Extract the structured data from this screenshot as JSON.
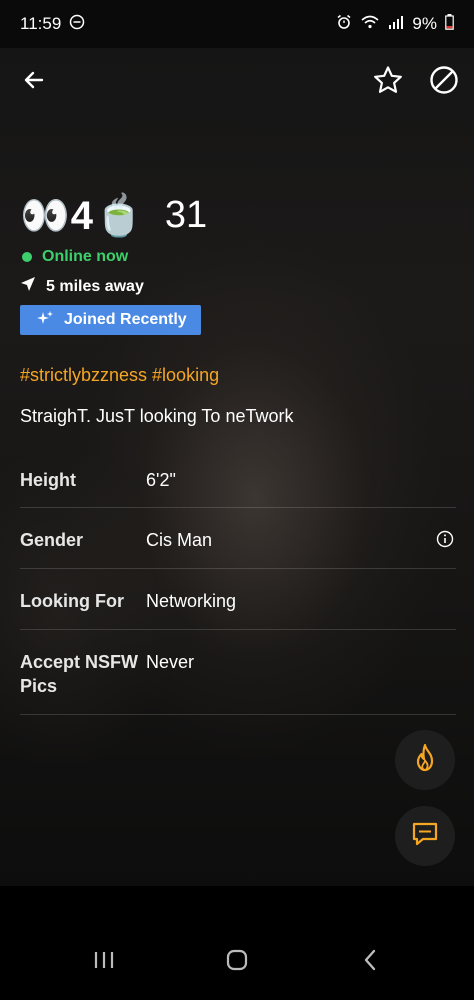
{
  "status_bar": {
    "time": "11:59",
    "battery": "9%"
  },
  "profile": {
    "display_name": "👀4🍵",
    "age": "31",
    "online_status": "Online now",
    "distance": "5 miles away",
    "badge": "Joined Recently",
    "tags": "#strictlybzzness #looking",
    "about": "StraighT. JusT looking To neTwork"
  },
  "details": [
    {
      "label": "Height",
      "value": "6'2\""
    },
    {
      "label": "Gender",
      "value": "Cis Man"
    },
    {
      "label": "Looking For",
      "value": "Networking"
    },
    {
      "label": "Accept NSFW Pics",
      "value": "Never"
    }
  ],
  "colors": {
    "online": "#3ccf6b",
    "badge": "#4b8ae4",
    "accent": "#f5a623"
  },
  "icons": {
    "back": "arrow-left-icon",
    "favorite": "star-icon",
    "block": "block-icon",
    "tap": "flame-icon",
    "chat": "chat-icon"
  }
}
